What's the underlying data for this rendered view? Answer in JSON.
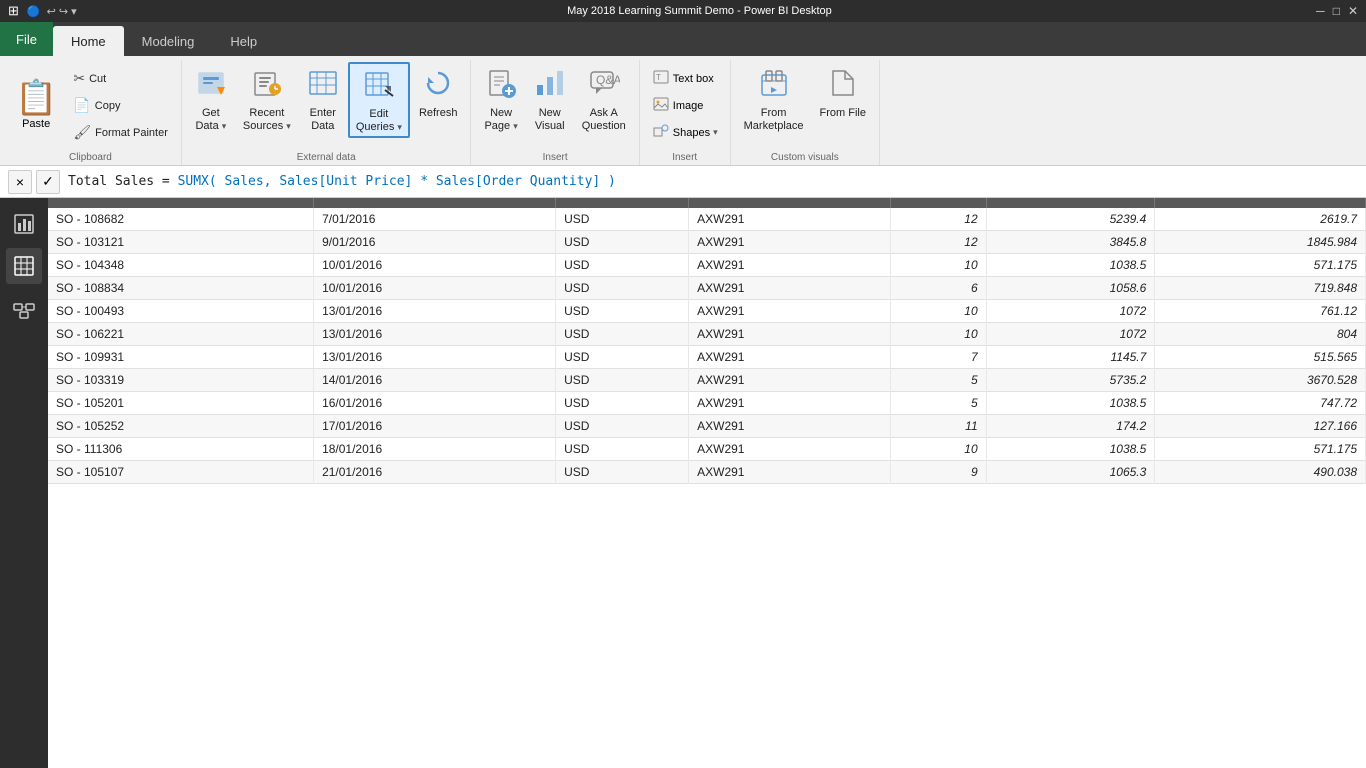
{
  "titlebar": {
    "text": "May 2018 Learning Summit Demo - Power BI Desktop"
  },
  "tabs": [
    {
      "id": "file",
      "label": "File",
      "active": false,
      "isFile": true
    },
    {
      "id": "home",
      "label": "Home",
      "active": true
    },
    {
      "id": "modeling",
      "label": "Modeling",
      "active": false
    },
    {
      "id": "help",
      "label": "Help",
      "active": false
    }
  ],
  "ribbon": {
    "clipboard": {
      "label": "Clipboard",
      "paste_label": "Paste",
      "paste_icon": "📋",
      "cut_label": "Cut",
      "cut_icon": "✂",
      "copy_label": "Copy",
      "copy_icon": "📄",
      "format_painter_label": "Format Painter",
      "format_painter_icon": "🖌"
    },
    "external_data": {
      "label": "External data",
      "get_data_label": "Get Data",
      "get_data_icon": "🗄",
      "recent_sources_label": "Recent Sources",
      "recent_sources_icon": "🕐",
      "enter_data_label": "Enter Data",
      "enter_data_icon": "📊",
      "edit_queries_label": "Edit Queries",
      "edit_queries_icon": "✏",
      "refresh_label": "Refresh",
      "refresh_icon": "🔄"
    },
    "insert": {
      "label": "Insert",
      "new_page_label": "New Page",
      "new_page_icon": "📄",
      "new_visual_label": "New Visual",
      "new_visual_icon": "📊",
      "ask_question_label": "Ask A Question",
      "ask_question_icon": "💬"
    },
    "insert_objects": {
      "label": "Insert",
      "text_box_label": "Text box",
      "text_box_icon": "🔤",
      "image_label": "Image",
      "image_icon": "🖼",
      "shapes_label": "Shapes",
      "shapes_icon": "⬛"
    },
    "custom_visuals": {
      "label": "Custom visuals",
      "from_marketplace_label": "From Marketplace",
      "from_marketplace_icon": "🏪",
      "from_file_label": "From File",
      "from_file_icon": "📁"
    }
  },
  "formula_bar": {
    "cancel_label": "×",
    "confirm_label": "✓",
    "formula_text": "Total Sales = ",
    "formula_dax": "SUMX( Sales, Sales[Unit Price] * Sales[Order Quantity] )"
  },
  "sidebar": {
    "icons": [
      {
        "id": "report",
        "icon": "📊",
        "active": false
      },
      {
        "id": "data",
        "icon": "⊞",
        "active": true
      },
      {
        "id": "model",
        "icon": "⊡",
        "active": false
      }
    ]
  },
  "table": {
    "columns": [
      "",
      "",
      "",
      "",
      "",
      "",
      ""
    ],
    "rows": [
      {
        "id": "SO - 108682",
        "date": "7/01/2016",
        "currency": "USD",
        "code": "AXW291",
        "qty": "12",
        "val1": "5239.4",
        "val2": "2619.7"
      },
      {
        "id": "SO - 103121",
        "date": "9/01/2016",
        "currency": "USD",
        "code": "AXW291",
        "qty": "12",
        "val1": "3845.8",
        "val2": "1845.984"
      },
      {
        "id": "SO - 104348",
        "date": "10/01/2016",
        "currency": "USD",
        "code": "AXW291",
        "qty": "10",
        "val1": "1038.5",
        "val2": "571.175"
      },
      {
        "id": "SO - 108834",
        "date": "10/01/2016",
        "currency": "USD",
        "code": "AXW291",
        "qty": "6",
        "val1": "1058.6",
        "val2": "719.848"
      },
      {
        "id": "SO - 100493",
        "date": "13/01/2016",
        "currency": "USD",
        "code": "AXW291",
        "qty": "10",
        "val1": "1072",
        "val2": "761.12"
      },
      {
        "id": "SO - 106221",
        "date": "13/01/2016",
        "currency": "USD",
        "code": "AXW291",
        "qty": "10",
        "val1": "1072",
        "val2": "804"
      },
      {
        "id": "SO - 109931",
        "date": "13/01/2016",
        "currency": "USD",
        "code": "AXW291",
        "qty": "7",
        "val1": "1145.7",
        "val2": "515.565"
      },
      {
        "id": "SO - 103319",
        "date": "14/01/2016",
        "currency": "USD",
        "code": "AXW291",
        "qty": "5",
        "val1": "5735.2",
        "val2": "3670.528"
      },
      {
        "id": "SO - 105201",
        "date": "16/01/2016",
        "currency": "USD",
        "code": "AXW291",
        "qty": "5",
        "val1": "1038.5",
        "val2": "747.72"
      },
      {
        "id": "SO - 105252",
        "date": "17/01/2016",
        "currency": "USD",
        "code": "AXW291",
        "qty": "11",
        "val1": "174.2",
        "val2": "127.166"
      },
      {
        "id": "SO - 111306",
        "date": "18/01/2016",
        "currency": "USD",
        "code": "AXW291",
        "qty": "10",
        "val1": "1038.5",
        "val2": "571.175"
      },
      {
        "id": "SO - 105107",
        "date": "21/01/2016",
        "currency": "USD",
        "code": "AXW291",
        "qty": "9",
        "val1": "1065.3",
        "val2": "490.038"
      }
    ]
  }
}
